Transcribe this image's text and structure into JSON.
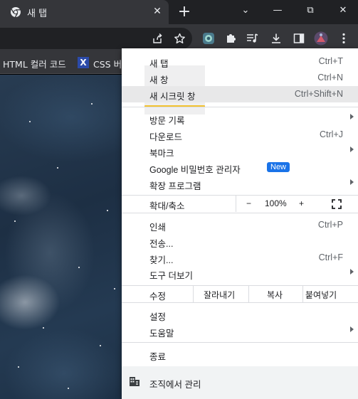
{
  "tab": {
    "title": "새 탭",
    "close_glyph": "✕",
    "new_tab_glyph": "+"
  },
  "window": {
    "dropdown_glyph": "⌄",
    "minimize_glyph": "—",
    "restore_glyph": "⧉",
    "close_glyph": "✕"
  },
  "bookmarks": [
    {
      "label": "HTML 컬러 코드"
    },
    {
      "icon_text": "X",
      "label": "CSS 버-"
    }
  ],
  "menu": {
    "items": {
      "new_tab": {
        "label": "새 탭",
        "shortcut": "Ctrl+T"
      },
      "new_window": {
        "label": "새 창",
        "shortcut": "Ctrl+N"
      },
      "new_incognito": {
        "label": "새 시크릿 창",
        "shortcut": "Ctrl+Shift+N"
      },
      "history": {
        "label": "방문 기록"
      },
      "downloads": {
        "label": "다운로드",
        "shortcut": "Ctrl+J"
      },
      "bookmarks": {
        "label": "북마크"
      },
      "password_manager": {
        "label": "Google 비밀번호 관리자",
        "badge": "New"
      },
      "extensions": {
        "label": "확장 프로그램"
      },
      "print": {
        "label": "인쇄",
        "shortcut": "Ctrl+P"
      },
      "cast": {
        "label": "전송..."
      },
      "find": {
        "label": "찾기...",
        "shortcut": "Ctrl+F"
      },
      "more_tools": {
        "label": "도구 더보기"
      },
      "settings": {
        "label": "설정"
      },
      "help": {
        "label": "도움말"
      },
      "exit": {
        "label": "종료"
      }
    },
    "zoom": {
      "label": "확대/축소",
      "minus": "−",
      "value": "100%",
      "plus": "+"
    },
    "edit": {
      "label": "수정",
      "cut": "잘라내기",
      "copy": "복사",
      "paste": "붙여넣기"
    },
    "managed": {
      "label": "조직에서 관리"
    }
  }
}
